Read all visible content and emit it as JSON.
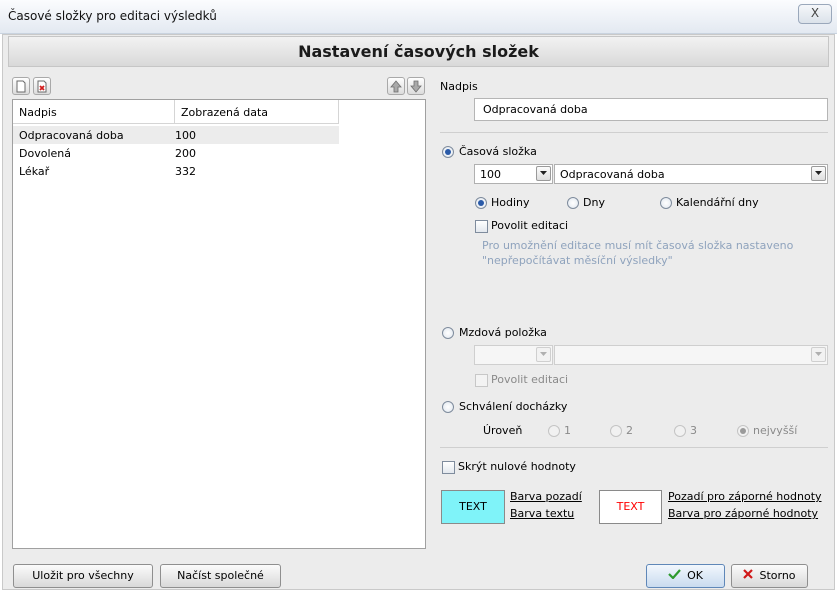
{
  "window": {
    "title": "Časové složky pro editaci výsledků",
    "close_symbol": "X"
  },
  "header": {
    "title": "Nastavení časových složek"
  },
  "toolbar": {
    "new_icon": "new-document-icon",
    "delete_icon": "delete-document-icon",
    "up_icon": "move-up-icon",
    "down_icon": "move-down-icon"
  },
  "list": {
    "columns": [
      "Nadpis",
      "Zobrazená data"
    ],
    "rows": [
      {
        "nadpis": "Odpracovaná doba",
        "data": "100"
      },
      {
        "nadpis": "Dovolená",
        "data": "200"
      },
      {
        "nadpis": "Lékař",
        "data": "332"
      }
    ]
  },
  "detail": {
    "nadpis_label": "Nadpis",
    "nadpis_value": "Odpracovaná doba",
    "casova_slozka": {
      "label": "Časová složka",
      "code": "100",
      "name": "Odpracovaná doba",
      "units": [
        "Hodiny",
        "Dny",
        "Kalendářní dny"
      ],
      "selected_unit": "Hodiny",
      "allow_edit_label": "Povolit editaci",
      "hint_line1": "Pro umožnění editace musí mít časová složka nastaveno",
      "hint_line2": "\"nepřepočítávat měsíční výsledky\""
    },
    "mzdova_polozka": {
      "label": "Mzdová položka",
      "allow_edit_label": "Povolit editaci"
    },
    "schvaleni": {
      "label": "Schválení docházky",
      "level_label": "Úroveň",
      "levels": [
        "1",
        "2",
        "3",
        "nejvyšší"
      ]
    },
    "hide_zero_label": "Skrýt nulové hodnoty",
    "colors": {
      "sample_text": "TEXT",
      "background_link": "Barva pozadí",
      "text_link": "Barva textu",
      "neg_background_link": "Pozadí pro záporné hodnoty",
      "neg_text_link": "Barva pro záporné hodnoty",
      "normal_bg": "#7ff3f9",
      "normal_fg": "#000000",
      "negative_bg": "#ffffff",
      "negative_fg": "#ff0000"
    }
  },
  "footer": {
    "save_all": "Uložit pro všechny",
    "load_common": "Načíst společné",
    "ok": "OK",
    "cancel": "Storno"
  }
}
